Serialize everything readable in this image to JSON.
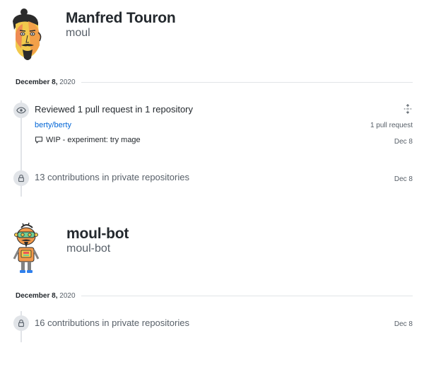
{
  "users": [
    {
      "name": "Manfred Touron",
      "login": "moul",
      "date": {
        "month_day": "December 8,",
        "year": "2020"
      },
      "review": {
        "title": "Reviewed 1 pull request in 1 repository",
        "repo": "berty/berty",
        "repo_count": "1 pull request",
        "pr_title": "WIP - experiment: try mage",
        "pr_date": "Dec 8"
      },
      "private": {
        "text": "13 contributions in private repositories",
        "date": "Dec 8"
      }
    },
    {
      "name": "moul-bot",
      "login": "moul-bot",
      "date": {
        "month_day": "December 8,",
        "year": "2020"
      },
      "private": {
        "text": "16 contributions in private repositories",
        "date": "Dec 8"
      }
    }
  ],
  "icons": {
    "eye": "eye-icon",
    "lock": "lock-icon",
    "comment": "comment-icon",
    "fold": "unfold-icon"
  },
  "colors": {
    "link": "#0366d6",
    "muted": "#586069",
    "badge": "#e1e4e8"
  }
}
